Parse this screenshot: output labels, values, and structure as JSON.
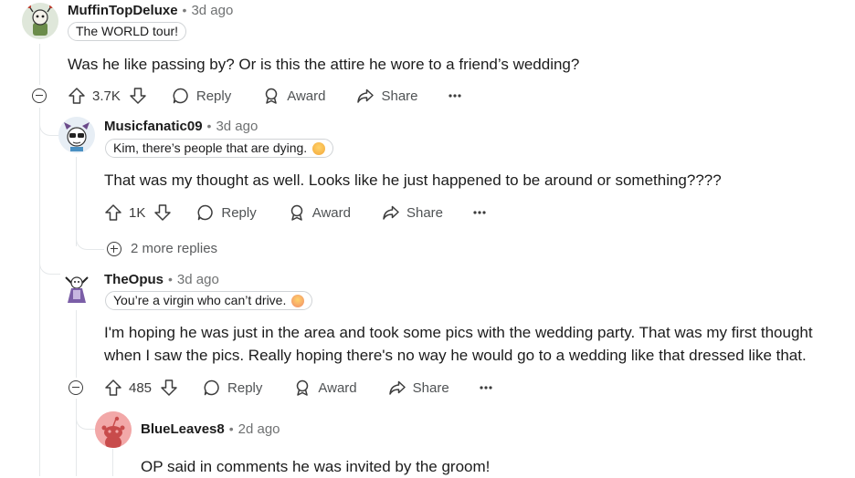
{
  "comments": [
    {
      "username": "MuffinTopDeluxe",
      "time": "3d ago",
      "flair": "The WORLD tour!",
      "text": "Was he like passing by? Or is this the attire he wore to a friend’s wedding?",
      "votes": "3.7K",
      "reply_label": "Reply",
      "award_label": "Award",
      "share_label": "Share"
    },
    {
      "username": "Musicfanatic09",
      "time": "3d ago",
      "flair": "Kim, there’s people that are dying.",
      "text": "That was my thought as well. Looks like he just happened to be around or something????",
      "votes": "1K",
      "reply_label": "Reply",
      "award_label": "Award",
      "share_label": "Share",
      "more_replies": "2 more replies"
    },
    {
      "username": "TheOpus",
      "time": "3d ago",
      "flair": "You’re a virgin who can’t drive.",
      "text_line1": "I'm hoping he was just in the area and took some pics with the wedding party. That was my first thought",
      "text_line2": "when I saw the pics. Really hoping there's no way he would go to a wedding like that dressed like that.",
      "votes": "485",
      "reply_label": "Reply",
      "award_label": "Award",
      "share_label": "Share"
    },
    {
      "username": "BlueLeaves8",
      "time": "2d ago",
      "text": "OP said in comments he was invited by the groom!"
    }
  ],
  "separator": "•",
  "colors": {
    "thread_line": "#e5e8ea",
    "snoo_avatar_bg": "#f2a8a8",
    "text": "#1c1c1c",
    "muted": "#6f7172"
  }
}
